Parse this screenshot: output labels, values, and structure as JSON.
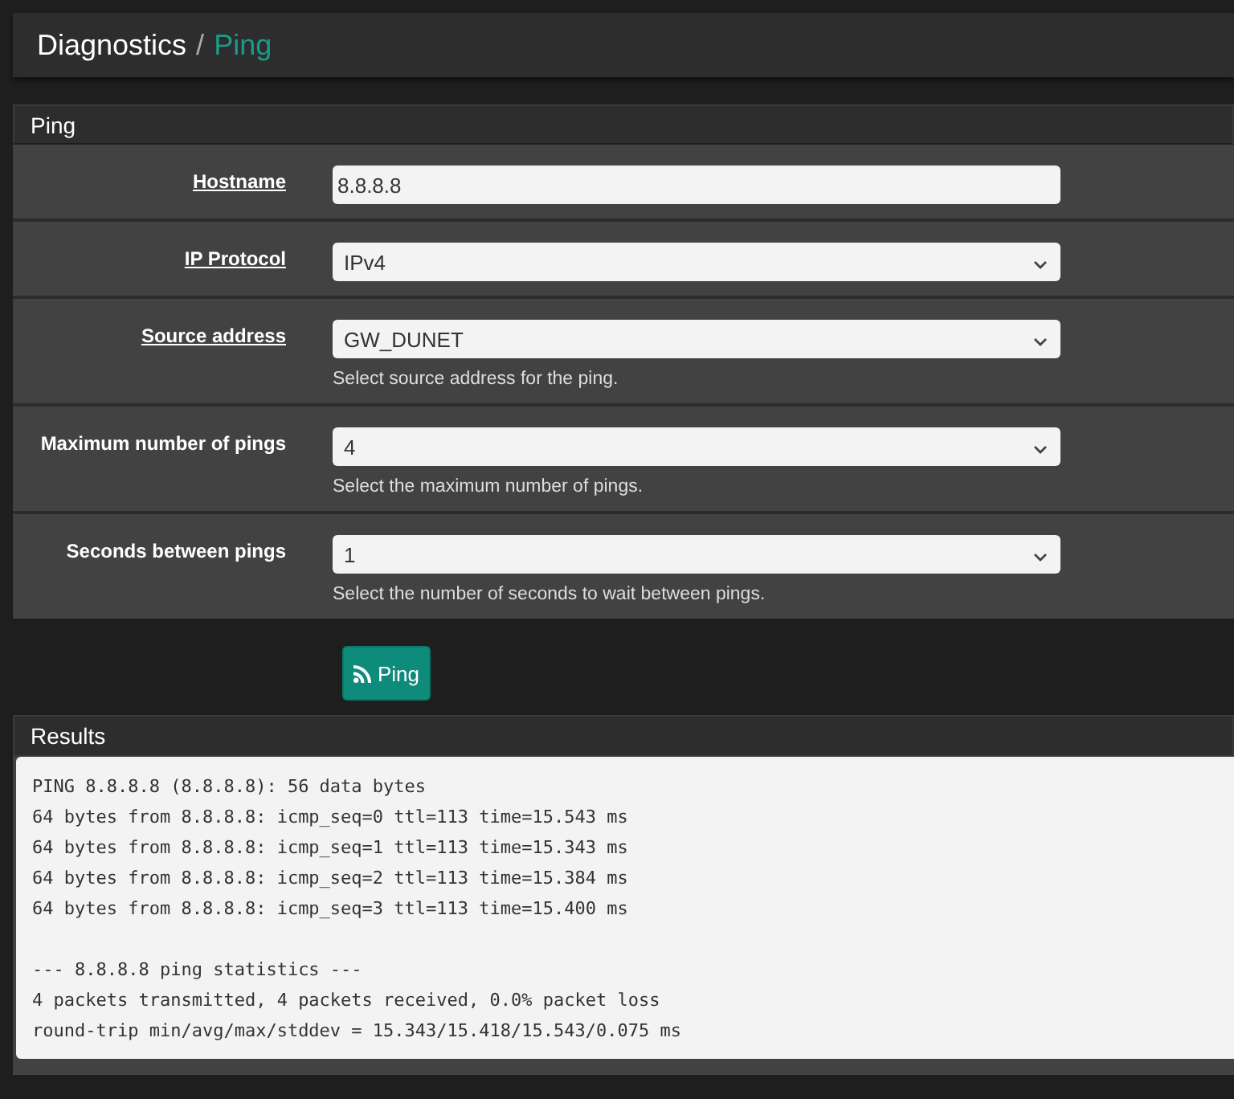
{
  "breadcrumb": {
    "section": "Diagnostics",
    "separator": "/",
    "page": "Ping"
  },
  "panel": {
    "title": "Ping",
    "fields": [
      {
        "label": "Hostname",
        "underlined": true,
        "kind": "text",
        "value": "8.8.8.8"
      },
      {
        "label": "IP Protocol",
        "underlined": true,
        "kind": "select",
        "value": "IPv4"
      },
      {
        "label": "Source address",
        "underlined": true,
        "kind": "select",
        "value": "GW_DUNET",
        "help": "Select source address for the ping."
      },
      {
        "label": "Maximum number of pings",
        "underlined": false,
        "kind": "select",
        "value": "4",
        "help": "Select the maximum number of pings."
      },
      {
        "label": "Seconds between pings",
        "underlined": false,
        "kind": "select",
        "value": "1",
        "help": "Select the number of seconds to wait between pings."
      }
    ]
  },
  "ping_button": {
    "label": "Ping"
  },
  "results": {
    "title": "Results",
    "output": "PING 8.8.8.8 (8.8.8.8): 56 data bytes\n64 bytes from 8.8.8.8: icmp_seq=0 ttl=113 time=15.543 ms\n64 bytes from 8.8.8.8: icmp_seq=1 ttl=113 time=15.343 ms\n64 bytes from 8.8.8.8: icmp_seq=2 ttl=113 time=15.384 ms\n64 bytes from 8.8.8.8: icmp_seq=3 ttl=113 time=15.400 ms\n\n--- 8.8.8.8 ping statistics ---\n4 packets transmitted, 4 packets received, 0.0% packet loss\nround-trip min/avg/max/stddev = 15.343/15.418/15.543/0.075 ms"
  }
}
